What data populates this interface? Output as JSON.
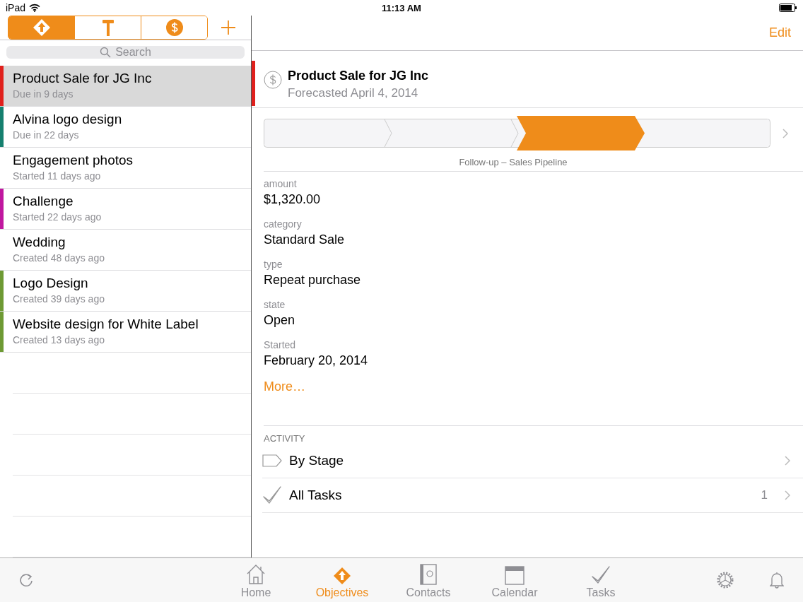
{
  "status_bar": {
    "device": "iPad",
    "time": "11:13 AM"
  },
  "segments": [
    {
      "kind": "objectives",
      "selected": true
    },
    {
      "kind": "hammer",
      "selected": false
    },
    {
      "kind": "dollar",
      "selected": false
    }
  ],
  "search": {
    "placeholder": "Search"
  },
  "items": [
    {
      "title": "Product Sale for JG Inc",
      "subtitle": "Due in 9 days",
      "color": "#e0201c",
      "selected": true
    },
    {
      "title": "Alvina logo design",
      "subtitle": "Due in 22 days",
      "color": "#15806f",
      "selected": false
    },
    {
      "title": "Engagement photos",
      "subtitle": "Started 11 days ago",
      "selected": false
    },
    {
      "title": "Challenge",
      "subtitle": "Started 22 days ago",
      "color": "#c0179f",
      "selected": false
    },
    {
      "title": "Wedding",
      "subtitle": "Created 48 days ago",
      "selected": false
    },
    {
      "title": "Logo Design",
      "subtitle": "Created 39 days ago",
      "color": "#6e9a34",
      "selected": false
    },
    {
      "title": "Website design for White Label",
      "subtitle": "Created 13 days ago",
      "color": "#6e9a34",
      "selected": false
    }
  ],
  "detail": {
    "edit": "Edit",
    "title": "Product Sale for JG Inc",
    "subtitle": "Forecasted April 4, 2014",
    "color": "#e0201c",
    "stages": [
      {
        "selected": false
      },
      {
        "selected": false
      },
      {
        "selected": true
      },
      {
        "selected": false
      }
    ],
    "pipeline_label": "Follow-up – Sales Pipeline",
    "fields": [
      {
        "label": "amount",
        "value": "$1,320.00"
      },
      {
        "label": "category",
        "value": "Standard Sale"
      },
      {
        "label": "type",
        "value": "Repeat purchase"
      },
      {
        "label": "state",
        "value": "Open"
      },
      {
        "label": "Started",
        "value": "February 20, 2014"
      }
    ],
    "more": "More…",
    "section": "ACTIVITY",
    "activity": [
      {
        "kind": "stage",
        "label": "By Stage"
      },
      {
        "kind": "tasks",
        "label": "All Tasks",
        "count": "1"
      }
    ]
  },
  "tab_bar": [
    {
      "kind": "home",
      "label": "Home",
      "selected": false
    },
    {
      "kind": "objectives",
      "label": "Objectives",
      "selected": true
    },
    {
      "kind": "contacts",
      "label": "Contacts",
      "selected": false
    },
    {
      "kind": "calendar",
      "label": "Calendar",
      "selected": false
    },
    {
      "kind": "tasks",
      "label": "Tasks",
      "selected": false
    }
  ]
}
